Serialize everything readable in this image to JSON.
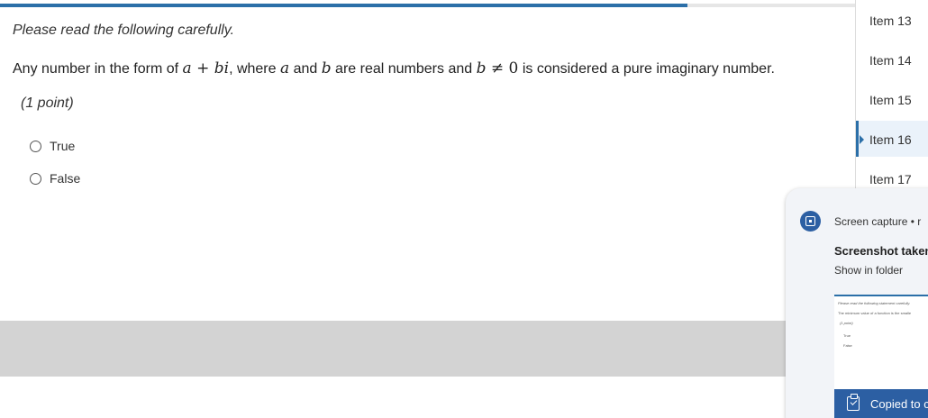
{
  "progress": {
    "fraction": 0.803
  },
  "question": {
    "instructions": "Please read the following carefully.",
    "text_before": "Any number in the form of ",
    "math_expr_a": "a",
    "math_plus": " + ",
    "math_expr_bi": "bi",
    "text_mid1": ", where ",
    "math_a": "a",
    "text_mid2": " and ",
    "math_b": "b",
    "text_mid3": " are real numbers and ",
    "math_b2": "b",
    "math_neq": " ≠ ",
    "math_zero": "0",
    "text_after": " is considered a pure imaginary number.",
    "points": "(1 point)",
    "choices": [
      "True",
      "False"
    ]
  },
  "item_nav": {
    "items": [
      {
        "label": "Item 13",
        "active": false
      },
      {
        "label": "Item 14",
        "active": false
      },
      {
        "label": "Item 15",
        "active": false
      },
      {
        "label": "Item 16",
        "active": true
      },
      {
        "label": "Item 17",
        "active": false
      }
    ]
  },
  "notification": {
    "source": "Screen capture • r",
    "title": "Screenshot taken",
    "link": "Show in folder",
    "thumbnail_lines": [
      "Please read the following statement carefully.",
      "The minimum value of a function is the smalle",
      "(1 point)",
      "True",
      "False"
    ],
    "copied": "Copied to c"
  },
  "colors": {
    "accent": "#2b6fa8",
    "notif_blue": "#2c5fa3",
    "band_grey": "#d3d3d3"
  }
}
